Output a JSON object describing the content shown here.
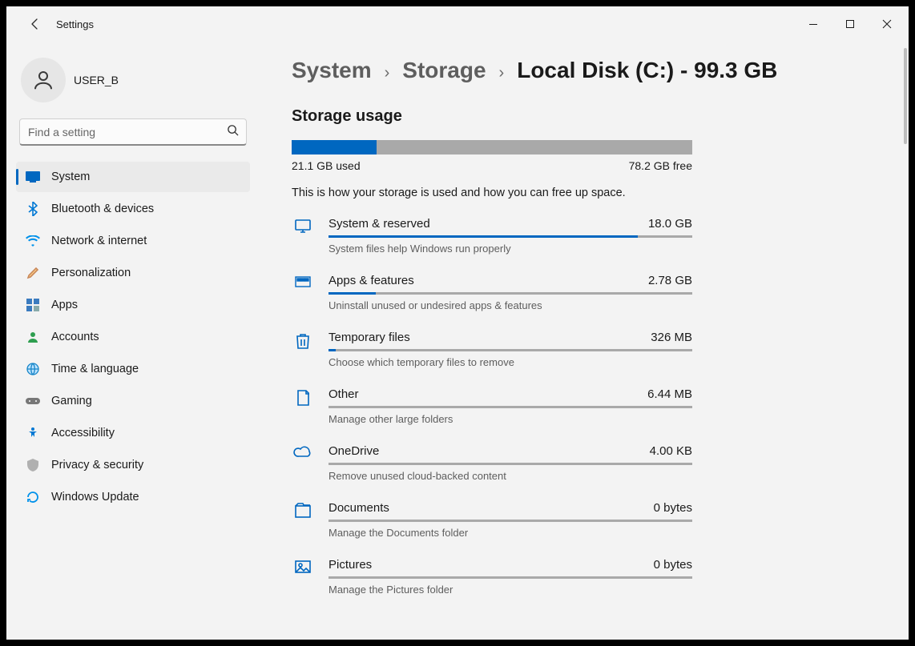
{
  "app": {
    "title": "Settings"
  },
  "user": {
    "name": "USER_B"
  },
  "search": {
    "placeholder": "Find a setting"
  },
  "nav": {
    "items": [
      {
        "label": "System"
      },
      {
        "label": "Bluetooth & devices"
      },
      {
        "label": "Network & internet"
      },
      {
        "label": "Personalization"
      },
      {
        "label": "Apps"
      },
      {
        "label": "Accounts"
      },
      {
        "label": "Time & language"
      },
      {
        "label": "Gaming"
      },
      {
        "label": "Accessibility"
      },
      {
        "label": "Privacy & security"
      },
      {
        "label": "Windows Update"
      }
    ]
  },
  "breadcrumb": {
    "a": "System",
    "b": "Storage",
    "current": "Local Disk (C:) - 99.3 GB"
  },
  "storage": {
    "section_title": "Storage usage",
    "used_label": "21.1 GB used",
    "free_label": "78.2 GB free",
    "used_pct": 21.25,
    "hint": "This is how your storage is used and how you can free up space."
  },
  "categories": [
    {
      "title": "System & reserved",
      "size": "18.0 GB",
      "desc": "System files help Windows run properly",
      "pct": 85
    },
    {
      "title": "Apps & features",
      "size": "2.78 GB",
      "desc": "Uninstall unused or undesired apps & features",
      "pct": 13
    },
    {
      "title": "Temporary files",
      "size": "326 MB",
      "desc": "Choose which temporary files to remove",
      "pct": 2
    },
    {
      "title": "Other",
      "size": "6.44 MB",
      "desc": "Manage other large folders",
      "pct": 0
    },
    {
      "title": "OneDrive",
      "size": "4.00 KB",
      "desc": "Remove unused cloud-backed content",
      "pct": 0
    },
    {
      "title": "Documents",
      "size": "0 bytes",
      "desc": "Manage the Documents folder",
      "pct": 0
    },
    {
      "title": "Pictures",
      "size": "0 bytes",
      "desc": "Manage the Pictures folder",
      "pct": 0
    }
  ]
}
